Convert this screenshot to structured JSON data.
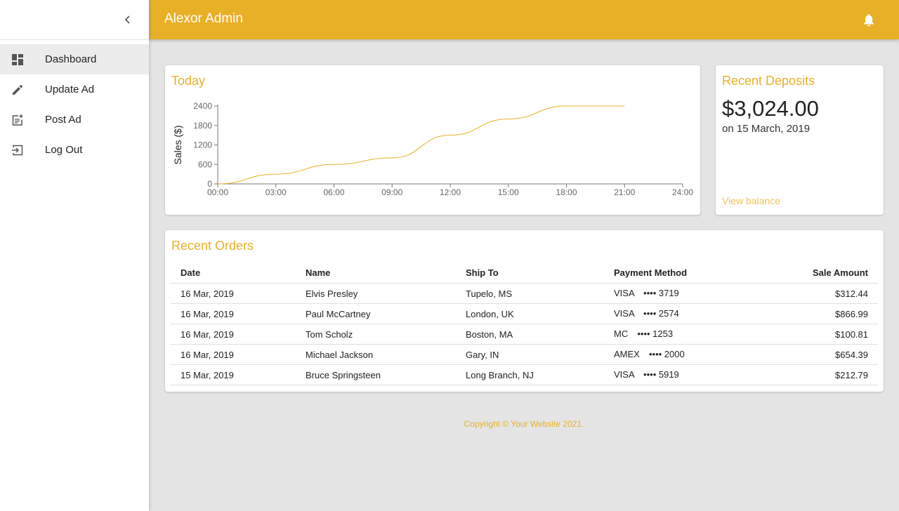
{
  "app": {
    "title": "Alexor Admin"
  },
  "colors": {
    "accent": "#e8b027",
    "link": "#efc35a",
    "background": "#e4e4e4"
  },
  "sidebar": {
    "collapse_icon": "chevron-left-icon",
    "items": [
      {
        "label": "Dashboard",
        "icon": "dashboard-icon",
        "active": true
      },
      {
        "label": "Update Ad",
        "icon": "pencil-icon",
        "active": false
      },
      {
        "label": "Post Ad",
        "icon": "post-add-icon",
        "active": false
      },
      {
        "label": "Log Out",
        "icon": "logout-icon",
        "active": false
      }
    ]
  },
  "header": {
    "notifications_icon": "bell-icon"
  },
  "chart_card": {
    "title": "Today"
  },
  "chart_data": {
    "type": "line",
    "title": "Today",
    "xlabel": "",
    "ylabel": "Sales ($)",
    "x_ticks": [
      "00:00",
      "03:00",
      "06:00",
      "09:00",
      "12:00",
      "15:00",
      "18:00",
      "21:00",
      "24:00"
    ],
    "y_ticks": [
      0,
      600,
      1200,
      1800,
      2400
    ],
    "ylim": [
      0,
      2400
    ],
    "xlim": [
      "00:00",
      "24:00"
    ],
    "grid": false,
    "series": [
      {
        "x": [
          "00:00",
          "03:00",
          "06:00",
          "09:00",
          "12:00",
          "15:00",
          "18:00",
          "21:00"
        ],
        "values": [
          0,
          300,
          600,
          800,
          1500,
          2000,
          2400,
          2400
        ]
      }
    ]
  },
  "deposits": {
    "title": "Recent Deposits",
    "amount": "$3,024.00",
    "date": "on 15 March, 2019",
    "link_label": "View balance"
  },
  "orders": {
    "title": "Recent Orders",
    "columns": [
      "Date",
      "Name",
      "Ship To",
      "Payment Method",
      "Sale Amount"
    ],
    "rows": [
      [
        "16 Mar, 2019",
        "Elvis Presley",
        "Tupelo, MS",
        "VISA ⠀•••• 3719",
        "$312.44"
      ],
      [
        "16 Mar, 2019",
        "Paul McCartney",
        "London, UK",
        "VISA ⠀•••• 2574",
        "$866.99"
      ],
      [
        "16 Mar, 2019",
        "Tom Scholz",
        "Boston, MA",
        "MC ⠀•••• 1253",
        "$100.81"
      ],
      [
        "16 Mar, 2019",
        "Michael Jackson",
        "Gary, IN",
        "AMEX ⠀•••• 2000",
        "$654.39"
      ],
      [
        "15 Mar, 2019",
        "Bruce Springsteen",
        "Long Branch, NJ",
        "VISA ⠀•••• 5919",
        "$212.79"
      ]
    ]
  },
  "footer": {
    "text": "Copyright © Your Website 2021."
  }
}
